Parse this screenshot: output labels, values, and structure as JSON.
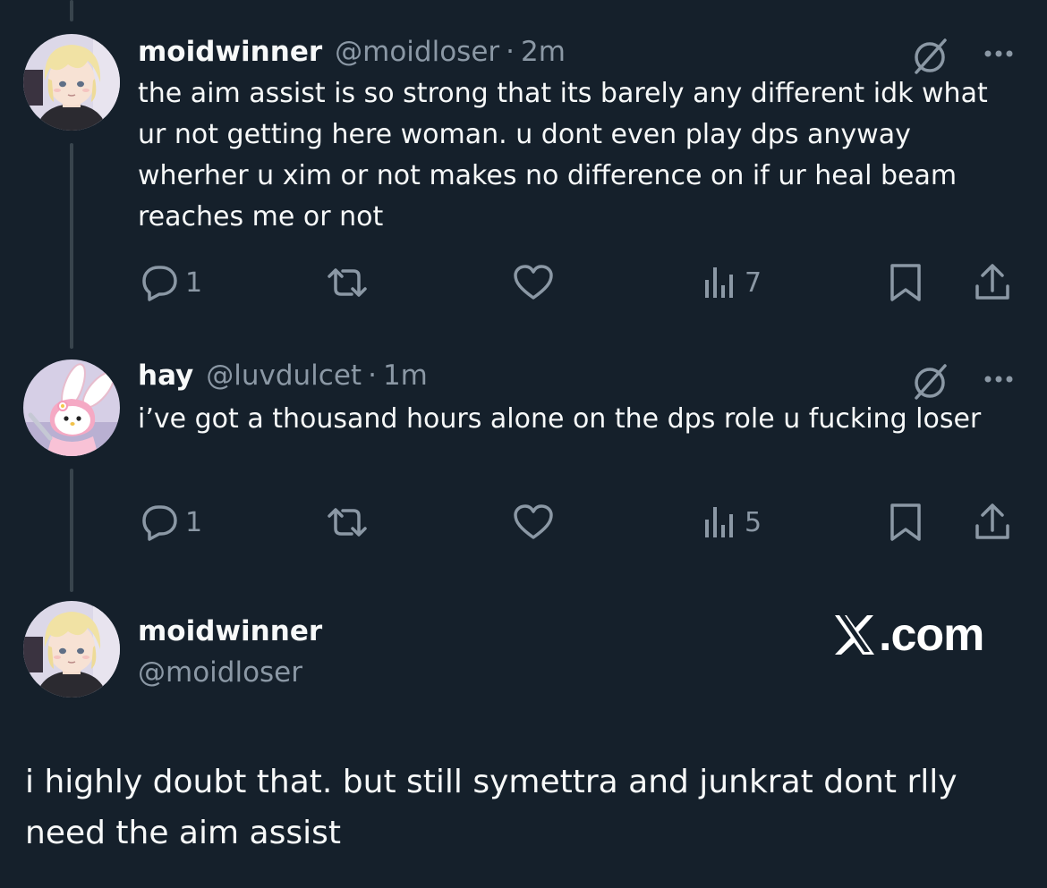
{
  "colors": {
    "background": "#15202b",
    "text": "#f7f9f9",
    "muted": "#8b98a5",
    "thread_line": "#38444d"
  },
  "replies": [
    {
      "display_name": "moidwinner",
      "handle": "@moidloser",
      "separator": "·",
      "time": "2m",
      "text": "the aim assist is so strong that its barely any different idk what ur not getting here woman. u dont even play dps anyway wherher u xim or not makes no difference on if ur heal beam reaches me or not",
      "reply_count": "1",
      "view_count": "7",
      "icons": [
        "grok-icon",
        "more-icon",
        "reply-icon",
        "retweet-icon",
        "like-icon",
        "views-icon",
        "bookmark-icon",
        "share-icon"
      ]
    },
    {
      "display_name": "hay",
      "handle": "@luvdulcet",
      "separator": "·",
      "time": "1m",
      "text": "i’ve got a thousand hours alone on the dps role u fucking loser",
      "reply_count": "1",
      "view_count": "5",
      "icons": [
        "grok-icon",
        "more-icon",
        "reply-icon",
        "retweet-icon",
        "like-icon",
        "views-icon",
        "bookmark-icon",
        "share-icon"
      ]
    }
  ],
  "main_tweet": {
    "display_name": "moidwinner",
    "handle": "@moidloser",
    "text": "i highly doubt that. but still symettra and junkrat dont rlly need the aim assist"
  },
  "branding": {
    "dotcom": ".com"
  }
}
